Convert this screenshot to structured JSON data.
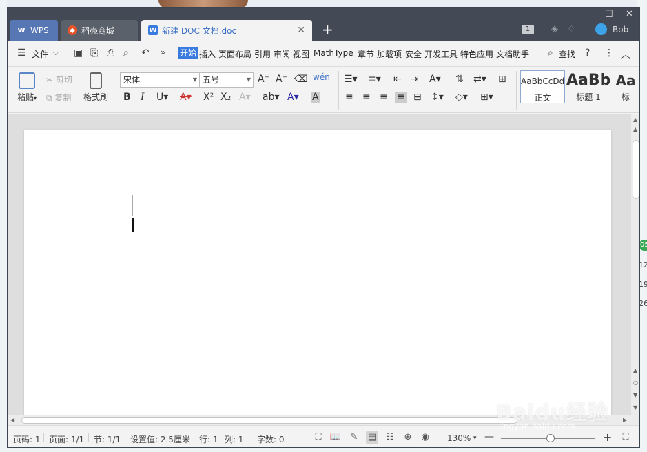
{
  "window": {
    "tabs": [
      {
        "label": "WPS"
      },
      {
        "label": "稻壳商城"
      },
      {
        "label": "新建 DOC 文档.doc"
      }
    ],
    "add_tab": "+",
    "badge": "1",
    "username": "Bob"
  },
  "menu": {
    "file": "文件",
    "items": [
      "开始",
      "插入",
      "页面布局",
      "引用",
      "审阅",
      "视图",
      "MathType",
      "章节",
      "加载项",
      "安全",
      "开发工具",
      "特色应用",
      "文档助手"
    ],
    "search": "查找"
  },
  "ribbon": {
    "paste": "粘贴",
    "cut": "剪切",
    "copy": "复制",
    "format_painter": "格式刷",
    "font_name": "宋体",
    "font_size": "五号",
    "styles": [
      {
        "preview": "AaBbCcDd",
        "label": "正文"
      },
      {
        "preview": "AaBb",
        "label": "标题 1"
      },
      {
        "preview": "Aa",
        "label": "标"
      }
    ]
  },
  "status": {
    "page": "页码: 1",
    "pages": "页面: 1/1",
    "section": "节: 1/1",
    "setting": "设置值: 2.5厘米",
    "row": "行: 1",
    "col": "列: 1",
    "words": "字数: 0",
    "zoom": "130%"
  },
  "watermark": {
    "main": "Baidu经验",
    "sub": "jingyan.baidu.com"
  },
  "background_peek": [
    "05",
    "12",
    "19",
    "26"
  ]
}
